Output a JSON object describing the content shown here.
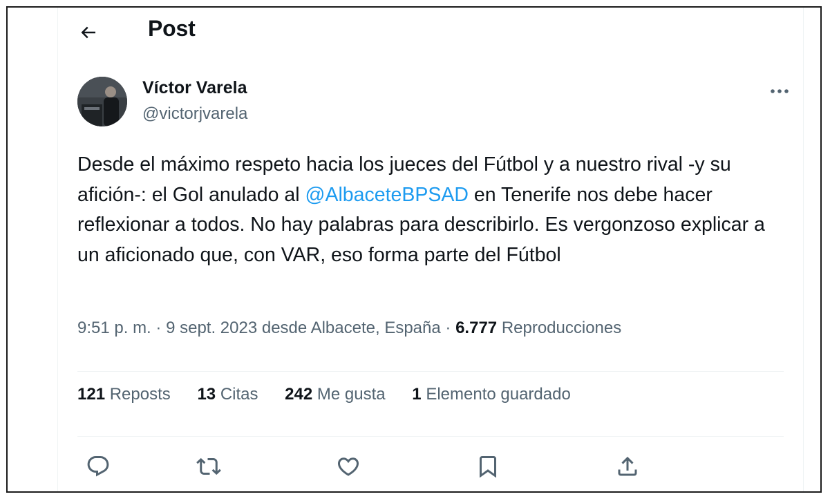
{
  "header": {
    "title": "Post"
  },
  "author": {
    "display_name": "Víctor Varela",
    "handle": "@victorjvarela"
  },
  "tweet": {
    "text_before": "Desde el máximo respeto hacia los jueces del Fútbol y a nuestro rival -y su afición-: el Gol anulado al ",
    "mention": "@AlbaceteBPSAD",
    "text_after": " en Tenerife nos debe hacer reflexionar a todos. No hay palabras para describirlo. Es vergonzoso explicar a un aficionado que, con VAR, eso forma parte del Fútbol"
  },
  "meta": {
    "time": "9:51 p. m.",
    "date": "9 sept. 2023",
    "location": "desde Albacete, España",
    "separator": "·",
    "views_count": "6.777",
    "views_label": "Reproducciones"
  },
  "stats": {
    "reposts_count": "121",
    "reposts_label": "Reposts",
    "quotes_count": "13",
    "quotes_label": "Citas",
    "likes_count": "242",
    "likes_label": "Me gusta",
    "bookmarks_count": "1",
    "bookmarks_label": "Elemento guardado"
  },
  "icons": {
    "back": "arrow-left-icon",
    "more": "more-horizontal-icon",
    "reply": "reply-icon",
    "repost": "repost-icon",
    "like": "heart-icon",
    "bookmark": "bookmark-icon",
    "share": "share-icon"
  },
  "colors": {
    "link": "#1d9bf0",
    "secondary_text": "#536471",
    "primary_text": "#0f1419",
    "divider": "#eff3f4"
  }
}
